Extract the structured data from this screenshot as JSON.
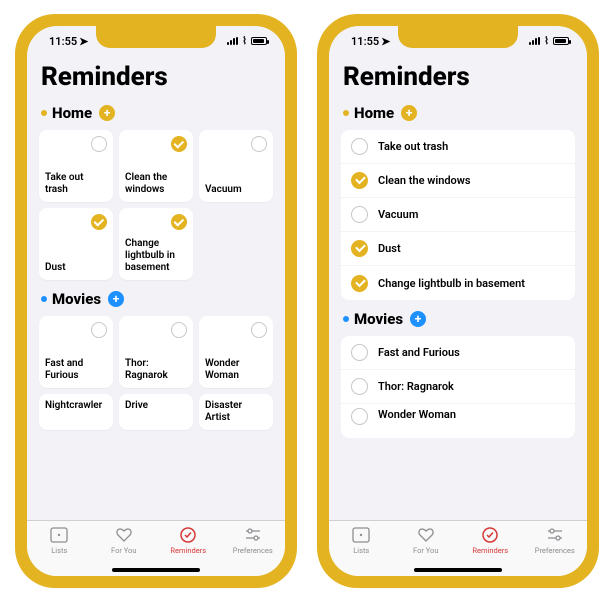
{
  "status": {
    "time": "11:55"
  },
  "title": "Reminders",
  "sections": {
    "home": {
      "name": "Home",
      "color": "yellow",
      "items": [
        {
          "label": "Take out trash",
          "done": false
        },
        {
          "label": "Clean the windows",
          "done": true
        },
        {
          "label": "Vacuum",
          "done": false
        },
        {
          "label": "Dust",
          "done": true
        },
        {
          "label": "Change lightbulb in basement",
          "done": true
        }
      ]
    },
    "movies": {
      "name": "Movies",
      "color": "blue",
      "items": [
        {
          "label": "Fast and Furious",
          "done": false
        },
        {
          "label": "Thor: Ragnarok",
          "done": false
        },
        {
          "label": "Wonder Woman",
          "done": false
        },
        {
          "label": "Nightcrawler",
          "done": false
        },
        {
          "label": "Drive",
          "done": false
        },
        {
          "label": "Disaster Artist",
          "done": false
        }
      ]
    }
  },
  "tabs": [
    {
      "label": "Lists",
      "active": false
    },
    {
      "label": "For You",
      "active": false
    },
    {
      "label": "Reminders",
      "active": true
    },
    {
      "label": "Preferences",
      "active": false
    }
  ]
}
